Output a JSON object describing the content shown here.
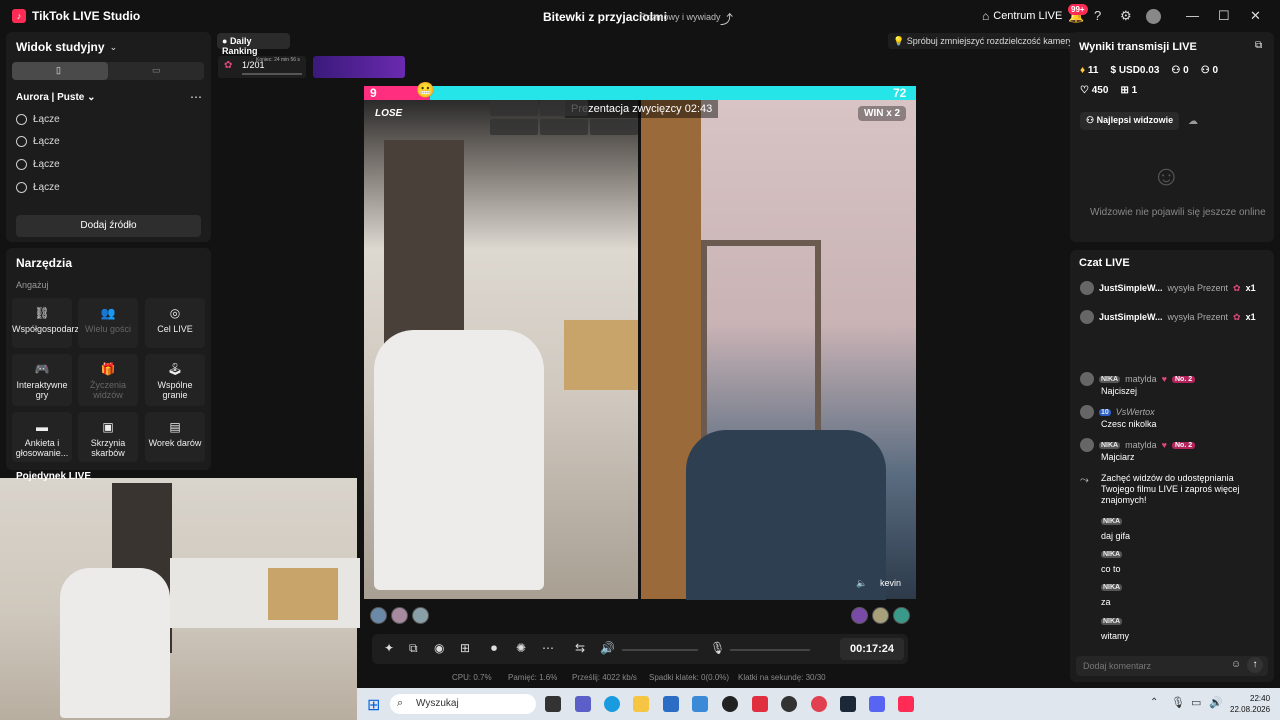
{
  "app": {
    "title": "TikTok LIVE Studio",
    "logo_icon": "tiktok-logo-icon"
  },
  "header": {
    "stream_title": "Bitewki z przyjaciolmi",
    "category": "Rozmowy i wywiady",
    "live_center": "Centrum LIVE",
    "notif_count": "99+"
  },
  "studio_view": {
    "label": "Widok studyjny",
    "scene": "Aurora | Puste",
    "sources": [
      "Łącze",
      "Łącze",
      "Łącze",
      "Łącze"
    ],
    "add_source": "Dodaj źródło"
  },
  "tools": {
    "title": "Narzędzia",
    "subtitle": "Angażuj",
    "items": [
      {
        "label": "Współgospodarz",
        "icon": "link-icon"
      },
      {
        "label": "Wielu gości",
        "icon": "users-icon"
      },
      {
        "label": "Cel LIVE",
        "icon": "target-icon"
      },
      {
        "label": "Interaktywne gry",
        "icon": "gamepad-icon"
      },
      {
        "label": "Życzenia widzów",
        "icon": "gift-icon"
      },
      {
        "label": "Wspólne granie",
        "icon": "joystick-icon"
      },
      {
        "label": "Ankieta i głosowanie...",
        "icon": "poll-icon"
      },
      {
        "label": "Skrzynia skarbów",
        "icon": "chest-icon"
      },
      {
        "label": "Worek darów",
        "icon": "bag-icon"
      }
    ],
    "battle_label": "Pojedynek LIVE"
  },
  "ranking": {
    "label": "Daily Ranking",
    "rank": "1/201",
    "time_left": "Koniec: 24 min 56 s"
  },
  "camera_hint": "Spróbuj zmniejszyć rozdzielczość kamery",
  "battle": {
    "score_left": "9",
    "score_right": "72",
    "lose_label": "LOSE",
    "win_label": "WIN x 2",
    "presentation": "Prezentacja zwycięzcy 02:43",
    "right_user": "kevin"
  },
  "controls": {
    "timer": "00:17:24"
  },
  "stats": {
    "cpu": "CPU: 0.7%",
    "memory": "Pamięć: 1.6%",
    "bitrate": "Prześlij: 4022 kb/s",
    "dropped": "Spadki klatek: 0(0.0%)",
    "fps": "Klatki na sekundę: 30/30"
  },
  "live_results": {
    "title": "Wyniki transmisji LIVE",
    "diamonds": "11",
    "usd": "USD0.03",
    "followers": "0",
    "new_followers": "0",
    "likes": "450",
    "gifts": "1",
    "top_viewers": "Najlepsi widzowie",
    "empty_state": "Widzowie nie pojawili się jeszcze online"
  },
  "chat": {
    "title": "Czat LIVE",
    "gift_events": [
      {
        "user": "JustSimpleW...",
        "action": "wysyła Prezent",
        "count": "x1"
      },
      {
        "user": "JustSimpleW...",
        "action": "wysyła Prezent",
        "count": "x1"
      }
    ],
    "messages": [
      {
        "tag": "NIKA",
        "user": "matylda",
        "badge": "No. 2",
        "text": "Najciszej"
      },
      {
        "tag": "10",
        "user": "VsWertox",
        "badge": "",
        "text": "Czesc nikolka"
      },
      {
        "tag": "NIKA",
        "user": "matylda",
        "badge": "No. 2",
        "text": "Majciarz"
      }
    ],
    "system_msg": "Zachęć widzów do udostępniania Twojego filmu LIVE i zaproś więcej znajomych!",
    "short_msgs": [
      {
        "tag": "NIKA",
        "text": "daj gifa"
      },
      {
        "tag": "NIKA",
        "text": "co to"
      },
      {
        "tag": "NIKA",
        "text": "za"
      },
      {
        "tag": "NIKA",
        "text": "witamy"
      }
    ],
    "input_placeholder": "Dodaj komentarz"
  },
  "taskbar": {
    "search": "Wyszukaj",
    "time": "22:40",
    "date": "22.08.2026"
  }
}
